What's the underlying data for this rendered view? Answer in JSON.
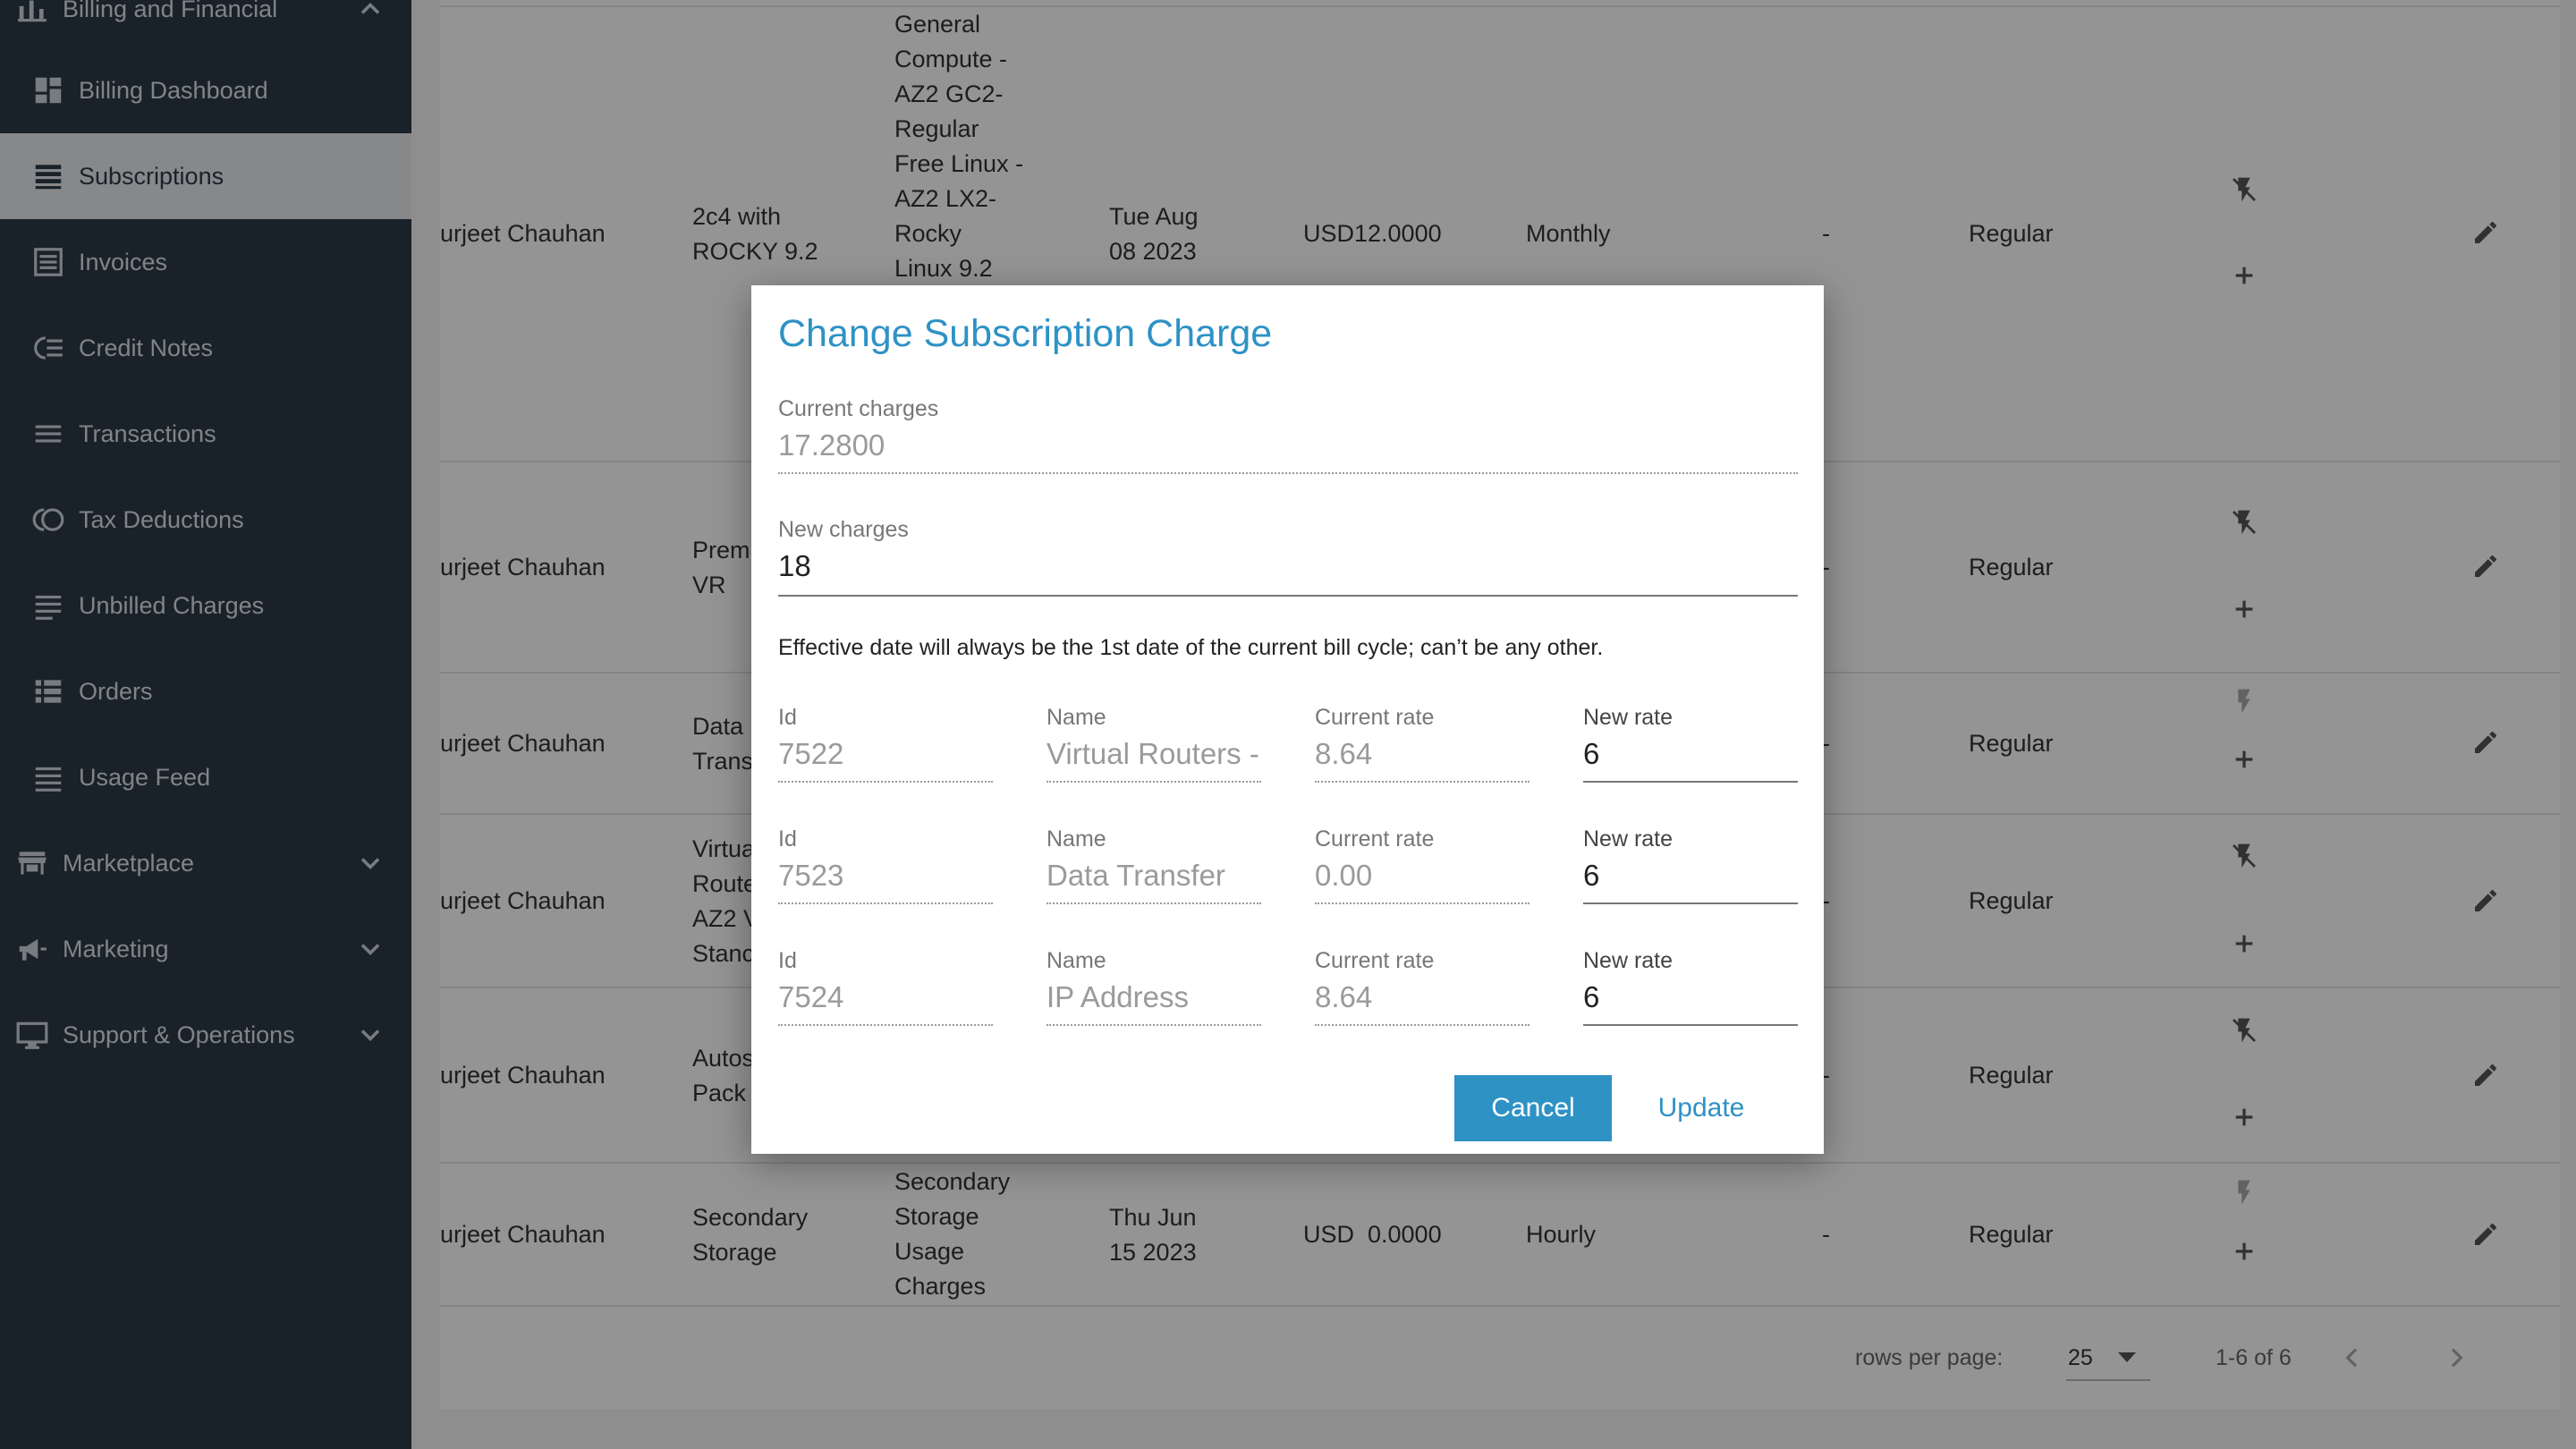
{
  "sidebar": {
    "section_billing": "Billing and Financial",
    "items": [
      {
        "label": "Billing Dashboard",
        "icon": "dashboard-icon"
      },
      {
        "label": "Subscriptions",
        "icon": "list-icon"
      },
      {
        "label": "Invoices",
        "icon": "invoice-icon"
      },
      {
        "label": "Credit Notes",
        "icon": "credit-notes-icon"
      },
      {
        "label": "Transactions",
        "icon": "transactions-icon"
      },
      {
        "label": "Tax Deductions",
        "icon": "tax-icon"
      },
      {
        "label": "Unbilled Charges",
        "icon": "unbilled-icon"
      },
      {
        "label": "Orders",
        "icon": "orders-icon"
      },
      {
        "label": "Usage Feed",
        "icon": "usage-icon"
      }
    ],
    "sections": [
      {
        "label": "Marketplace",
        "icon": "store-icon"
      },
      {
        "label": "Marketing",
        "icon": "megaphone-icon"
      },
      {
        "label": "Support & Operations",
        "icon": "monitor-icon"
      }
    ]
  },
  "table": {
    "rows": [
      {
        "customer": "urjeet Chauhan",
        "product": [
          "2c4 with",
          "ROCKY 9.2"
        ],
        "plan": [
          "General",
          "Compute -",
          "AZ2 GC2-",
          "Regular",
          "Free Linux -",
          "AZ2 LX2-",
          "Rocky",
          "Linux 9.2"
        ],
        "date": [
          "Tue Aug",
          "08 2023"
        ],
        "charge": "USD12.0000",
        "period": "Monthly",
        "dash": "-",
        "type": "Regular"
      },
      {
        "customer": "urjeet Chauhan",
        "product": [
          "Prem",
          "VR"
        ],
        "type": "Regular",
        "dash": "-"
      },
      {
        "customer": "urjeet Chauhan",
        "product": [
          "Data",
          "Trans"
        ],
        "type": "Regular",
        "dash": "-"
      },
      {
        "customer": "urjeet Chauhan",
        "product": [
          "Virtua",
          "Route",
          "AZ2 V",
          "Stanc"
        ],
        "type": "Regular",
        "dash": "-"
      },
      {
        "customer": "urjeet Chauhan",
        "product": [
          "Autos",
          "Pack"
        ],
        "type": "Regular",
        "dash": "-"
      },
      {
        "customer": "urjeet Chauhan",
        "product": [
          "Secondary",
          "Storage"
        ],
        "plan": [
          "Secondary",
          "Storage",
          "Usage",
          "Charges"
        ],
        "date": [
          "Thu Jun",
          "15 2023"
        ],
        "charge": "USD  0.0000",
        "period": "Hourly",
        "dash": "-",
        "type": "Regular"
      }
    ],
    "pagination": {
      "rows_label": "rows per page:",
      "rows_value": "25",
      "range": "1-6 of 6"
    }
  },
  "dialog": {
    "title": "Change Subscription Charge",
    "current_label": "Current charges",
    "current_value": "17.2800",
    "new_label": "New charges",
    "new_value": "18",
    "note": "Effective date will always be the 1st date of the current bill cycle; can’t be any other.",
    "col_labels": {
      "id": "Id",
      "name": "Name",
      "current": "Current rate",
      "new": "New rate"
    },
    "rates": [
      {
        "id": "7522",
        "name": "Virtual Routers -",
        "current": "8.64",
        "new": "6"
      },
      {
        "id": "7523",
        "name": "Data Transfer",
        "current": "0.00",
        "new": "6"
      },
      {
        "id": "7524",
        "name": "IP Address",
        "current": "8.64",
        "new": "6"
      }
    ],
    "cancel_label": "Cancel",
    "update_label": "Update"
  },
  "colors": {
    "accent": "#2e92c5",
    "sidebar": "#2c3a47"
  }
}
